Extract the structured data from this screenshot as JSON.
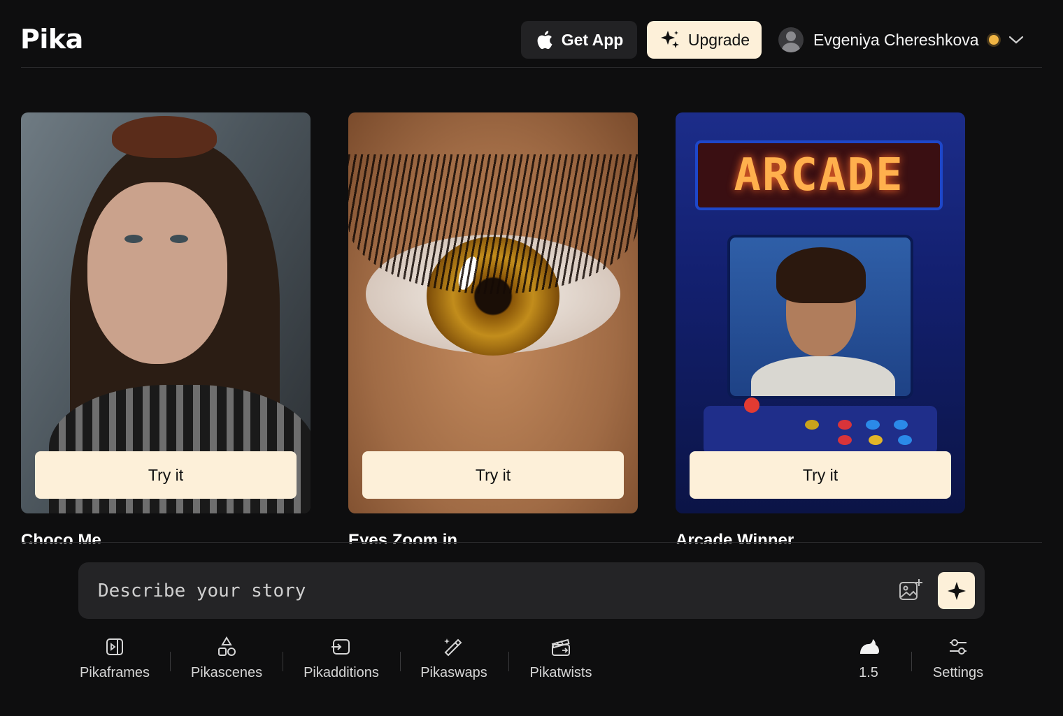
{
  "header": {
    "logo": "Pika",
    "get_app_label": "Get App",
    "upgrade_label": "Upgrade",
    "user_name": "Evgeniya Chereshkova"
  },
  "cards": [
    {
      "title": "Choco Me",
      "button": "Try it"
    },
    {
      "title": "Eyes Zoom in",
      "button": "Try it"
    },
    {
      "title": "Arcade Winner",
      "button": "Try it",
      "image_text": "ARCADE"
    }
  ],
  "prompt": {
    "placeholder": "Describe your story"
  },
  "toolbar": {
    "items": [
      {
        "label": "Pikaframes",
        "icon": "frames-icon"
      },
      {
        "label": "Pikascenes",
        "icon": "shapes-icon"
      },
      {
        "label": "Pikadditions",
        "icon": "add-into-icon"
      },
      {
        "label": "Pikaswaps",
        "icon": "wand-icon"
      },
      {
        "label": "Pikatwists",
        "icon": "clapperboard-icon"
      }
    ],
    "model_version": "1.5",
    "settings_label": "Settings"
  },
  "colors": {
    "background": "#0e0e0f",
    "accent": "#fdf0d9",
    "credit_dot": "#f0b544"
  }
}
